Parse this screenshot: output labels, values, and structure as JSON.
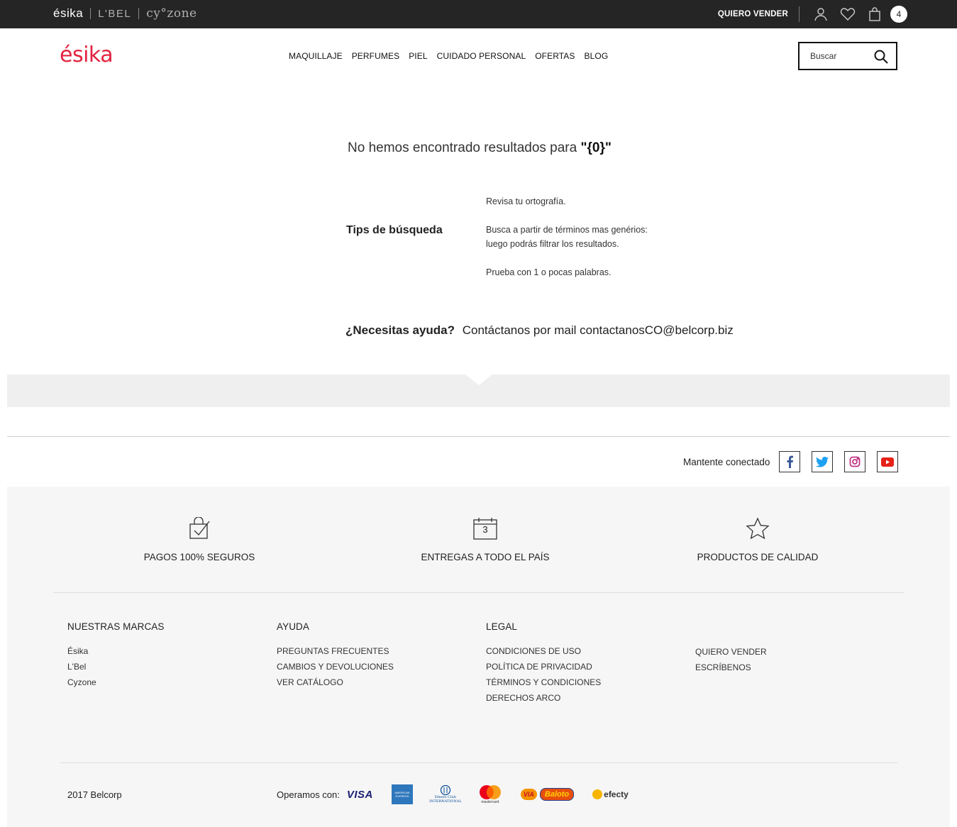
{
  "topbar": {
    "brands": [
      "ésika",
      "L'BEL",
      "cy°zone"
    ],
    "sell_label": "QUIERO VENDER",
    "cart_count": "4",
    "icons": [
      "user-icon",
      "heart-icon",
      "bag-icon"
    ]
  },
  "header": {
    "logo": "ésika",
    "nav": [
      "MAQUILLAJE",
      "PERFUMES",
      "PIEL",
      "CUIDADO PERSONAL",
      "OFERTAS",
      "BLOG"
    ],
    "search_placeholder": "Buscar"
  },
  "results": {
    "message": "No hemos encontrado resultados para",
    "query": "\"{0}\"",
    "tips_title": "Tips de búsqueda",
    "tips": [
      "Revisa tu ortografía.",
      "Busca a partir de términos mas genérios:",
      "luego podrás filtrar los resultados.",
      "Prueba con 1 o pocas palabras."
    ],
    "help_question": "¿Necesitas ayuda?",
    "help_text": "Contáctanos por mail contactanosCO@belcorp.biz"
  },
  "footer": {
    "social_label": "Mantente conectado",
    "social": [
      "facebook-icon",
      "twitter-icon",
      "instagram-icon",
      "youtube-icon"
    ],
    "features": [
      {
        "icon": "secure-bag-icon",
        "label": "PAGOS 100% SEGUROS"
      },
      {
        "icon": "calendar-icon",
        "icon_text": "3",
        "label": "ENTREGAS A TODO EL PAÍS"
      },
      {
        "icon": "star-icon",
        "label": "PRODUCTOS  DE CALIDAD"
      }
    ],
    "columns": [
      {
        "title": "NUESTRAS MARCAS",
        "links": [
          "Ésika",
          "L'Bel",
          "Cyzone"
        ]
      },
      {
        "title": "AYUDA",
        "links": [
          "PREGUNTAS FRECUENTES",
          "CAMBIOS Y DEVOLUCIONES",
          "VER CATÁLOGO"
        ]
      },
      {
        "title": "LEGAL",
        "links": [
          "CONDICIONES DE USO",
          "POLÍTICA DE PRIVACIDAD",
          "TÉRMINOS Y CONDICIONES",
          "DERECHOS ARCO"
        ]
      },
      {
        "title": "",
        "links": [
          "QUIERO VENDER",
          "ESCRÍBENOS"
        ]
      }
    ],
    "copyright": "2017 Belcorp",
    "pay_label": "Operamos con:",
    "payments": {
      "visa": "VISA",
      "amex": "AMERICAN EXPRESS",
      "diners": "Diners Club INTERNATIONAL",
      "mastercard": "mastercard",
      "via": "VIA",
      "baloto": "Baloto",
      "efecty": "efecty"
    }
  },
  "colors": {
    "brand": "#e2233f",
    "topbar": "#252525",
    "footer_bg": "#f6f6f6"
  }
}
